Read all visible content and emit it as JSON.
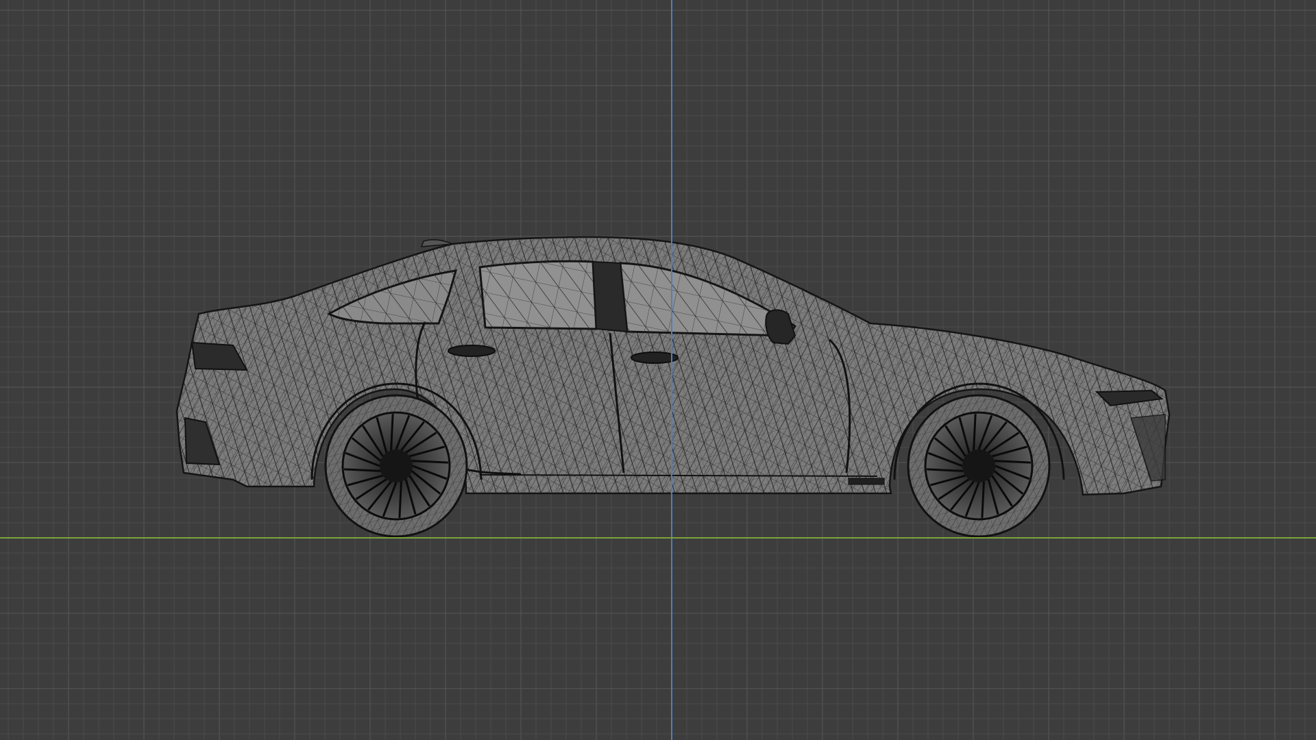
{
  "viewport": {
    "background": "#3d3d3d",
    "grid_minor_color": "#4a4a4a",
    "grid_major_color": "#535353"
  },
  "axes": {
    "z_color": "#4f7fbf",
    "x_color": "#7ea33a"
  },
  "model": {
    "fill_color": "#7c7c7c",
    "wire_color": "#1b1b1b",
    "glass_color": "#8d8d8d",
    "view": "side-wireframe"
  }
}
